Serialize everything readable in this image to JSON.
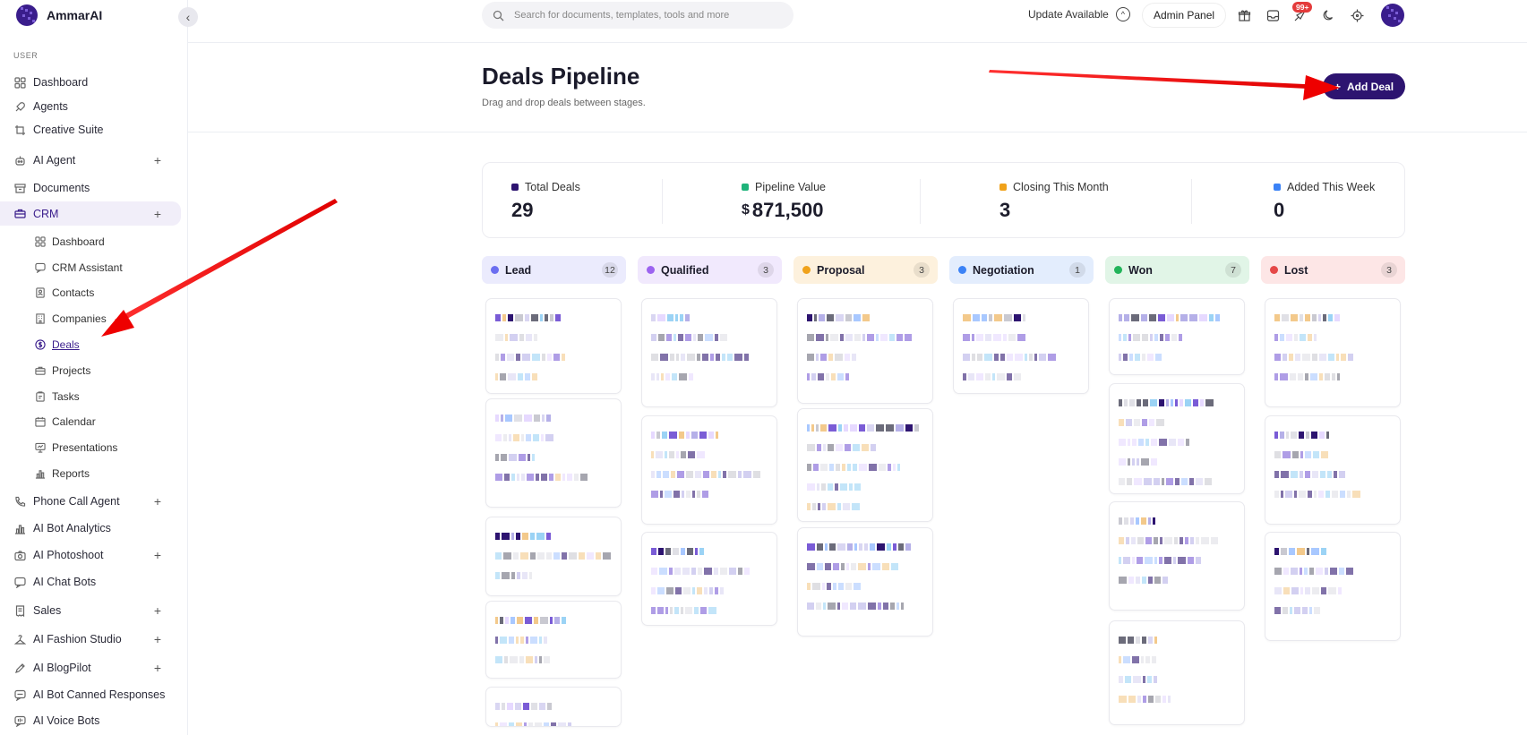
{
  "brand": {
    "name": "AmmarAI"
  },
  "sidebar": {
    "section_label": "USER",
    "items": [
      {
        "label": "Dashboard",
        "icon": "grid-icon"
      },
      {
        "label": "Agents",
        "icon": "rocket-icon"
      },
      {
        "label": "Creative Suite",
        "icon": "crop-icon"
      },
      {
        "label": "AI Agent",
        "icon": "robot-icon",
        "plus": "+"
      },
      {
        "label": "Documents",
        "icon": "archive-icon"
      },
      {
        "label": "CRM",
        "icon": "briefcase-icon",
        "plus": "+"
      },
      {
        "label": "Phone Call Agent",
        "icon": "phone-icon",
        "plus": "+"
      },
      {
        "label": "AI Bot Analytics",
        "icon": "bar-chart-icon"
      },
      {
        "label": "AI Photoshoot",
        "icon": "camera-icon",
        "plus": "+"
      },
      {
        "label": "AI Chat Bots",
        "icon": "chat-icon"
      },
      {
        "label": "Sales",
        "icon": "receipt-icon",
        "plus": "+"
      },
      {
        "label": "AI Fashion Studio",
        "icon": "hanger-icon",
        "plus": "+"
      },
      {
        "label": "AI BlogPilot",
        "icon": "pen-icon",
        "plus": "+"
      },
      {
        "label": "AI Bot Canned Responses",
        "icon": "message-icon"
      },
      {
        "label": "AI Voice Bots",
        "icon": "voice-icon"
      }
    ],
    "crm_sub": [
      {
        "label": "Dashboard",
        "icon": "grid-icon"
      },
      {
        "label": "CRM Assistant",
        "icon": "chat-icon"
      },
      {
        "label": "Contacts",
        "icon": "contact-icon"
      },
      {
        "label": "Companies",
        "icon": "building-icon"
      },
      {
        "label": "Deals",
        "icon": "dollar-icon"
      },
      {
        "label": "Projects",
        "icon": "briefcase-icon"
      },
      {
        "label": "Tasks",
        "icon": "clipboard-icon"
      },
      {
        "label": "Calendar",
        "icon": "calendar-icon"
      },
      {
        "label": "Presentations",
        "icon": "presentation-icon"
      },
      {
        "label": "Reports",
        "icon": "bar-chart-icon"
      }
    ]
  },
  "topbar": {
    "search_placeholder": "Search for documents, templates, tools and more",
    "update_label": "Update Available",
    "admin_label": "Admin Panel",
    "notification_badge": "99+"
  },
  "header": {
    "title": "Deals Pipeline",
    "subtitle": "Drag and drop deals between stages.",
    "add_button": "Add Deal",
    "add_icon": "+"
  },
  "stats": [
    {
      "label": "Total Deals",
      "value": "29",
      "color": "#2d1470"
    },
    {
      "label": "Pipeline Value",
      "currency": "$",
      "value": "871,500",
      "color": "#1fb37a"
    },
    {
      "label": "Closing This Month",
      "value": "3",
      "color": "#f0a21a"
    },
    {
      "label": "Added This Week",
      "value": "0",
      "color": "#3b82f6"
    }
  ],
  "columns": [
    {
      "name": "Lead",
      "count": "12",
      "dot": "#6b6ef0",
      "bg": "#ebebfd"
    },
    {
      "name": "Qualified",
      "count": "3",
      "dot": "#9c63f0",
      "bg": "#f1e9fd"
    },
    {
      "name": "Proposal",
      "count": "3",
      "dot": "#f0a21a",
      "bg": "#fdf1dd"
    },
    {
      "name": "Negotiation",
      "count": "1",
      "dot": "#3b82f6",
      "bg": "#e3edfd"
    },
    {
      "name": "Won",
      "count": "7",
      "dot": "#22b45a",
      "bg": "#e1f5e7"
    },
    {
      "name": "Lost",
      "count": "3",
      "dot": "#e54848",
      "bg": "#fde6e6"
    }
  ]
}
